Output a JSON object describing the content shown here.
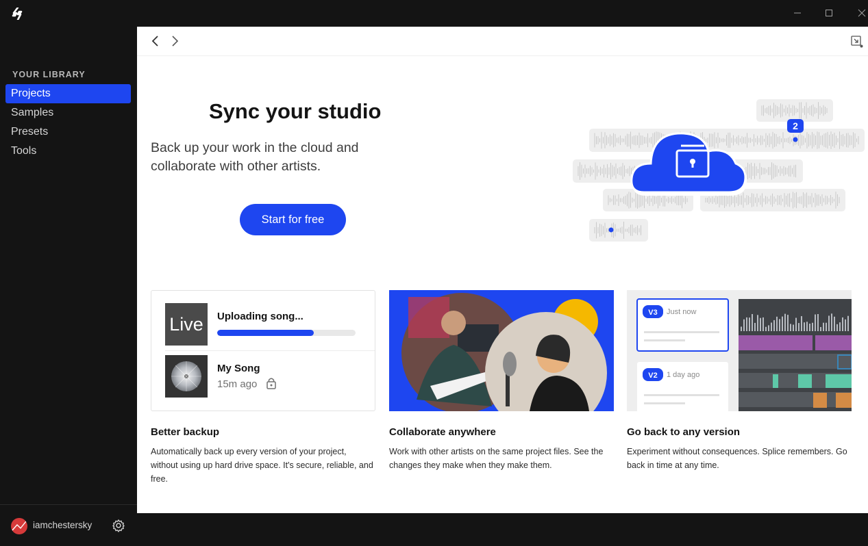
{
  "window": {
    "logo_icon": "splice-logo-icon",
    "controls": [
      "minimize-icon",
      "maximize-icon",
      "close-icon"
    ]
  },
  "sidebar": {
    "section_title": "YOUR LIBRARY",
    "items": [
      {
        "label": "Projects",
        "active": true
      },
      {
        "label": "Samples",
        "active": false
      },
      {
        "label": "Presets",
        "active": false
      },
      {
        "label": "Tools",
        "active": false
      }
    ],
    "user": {
      "name": "iamchestersky",
      "avatar_color": "#d63a3a"
    },
    "settings_icon": "gear-icon"
  },
  "colors": {
    "accent": "#1e46f0",
    "sidebar_bg": "#141414",
    "main_bg": "#ffffff"
  },
  "hero": {
    "title": "Sync your studio",
    "subtitle": "Back up your work in the cloud and collaborate with other artists.",
    "cta_label": "Start for free",
    "illustration_badge": "2"
  },
  "cards": [
    {
      "title": "Better backup",
      "desc": "Automatically back up every version of your project, without using up hard drive space. It's secure, reliable, and free.",
      "tile_label": "Live",
      "upload_label": "Uploading song...",
      "upload_progress": 0.7,
      "song_name": "My Song",
      "song_time": "15m ago"
    },
    {
      "title": "Collaborate anywhere",
      "desc": "Work with other artists on the same project files. See the changes they make when they make them."
    },
    {
      "title": "Go back to any version",
      "desc": "Experiment without consequences. Splice remembers. Go back in time at any time.",
      "versions": [
        {
          "badge": "V3",
          "time": "Just now"
        },
        {
          "badge": "V2",
          "time": "1 day ago"
        }
      ]
    }
  ]
}
